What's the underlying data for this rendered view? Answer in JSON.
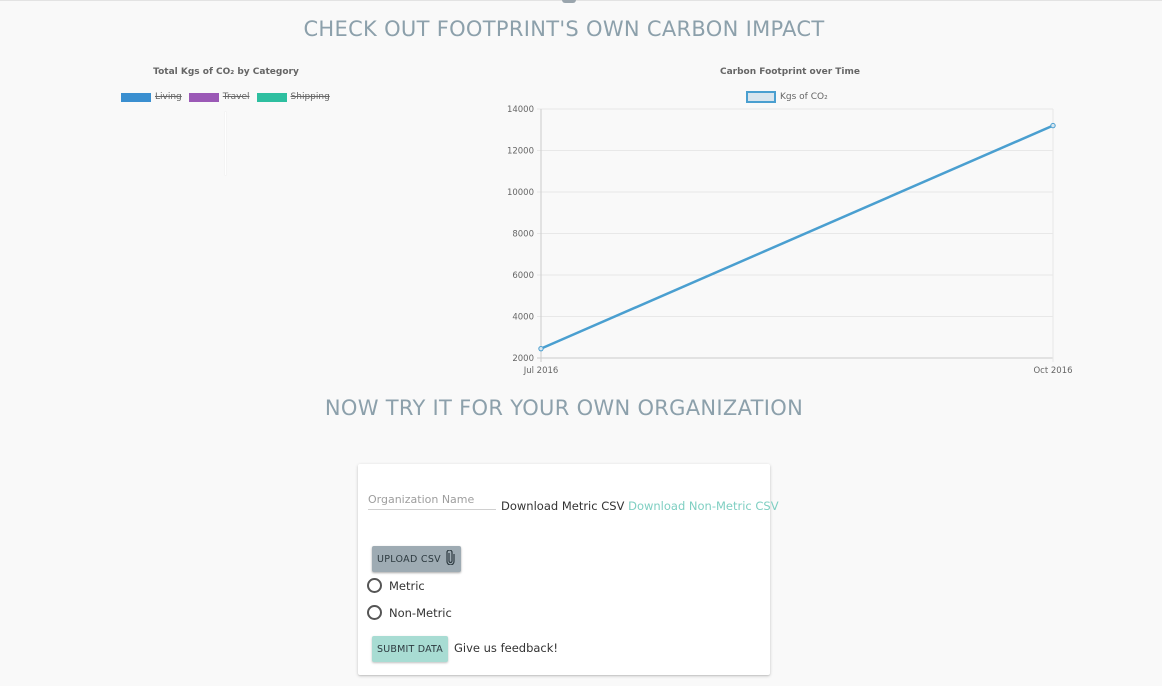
{
  "page": {
    "title_own": "CHECK OUT FOOTPRINT'S OWN CARBON IMPACT",
    "title_try": "NOW TRY IT FOR YOUR OWN ORGANIZATION"
  },
  "colors": {
    "living": "#3a8fd0",
    "travel": "#9b59b6",
    "shipping": "#2ebfa0",
    "line": "#4a9fd0",
    "heading": "#8ca0ab",
    "link_accent": "#7fcfc2"
  },
  "pie_chart": {
    "title": "Total Kgs of CO₂ by Category",
    "legend": [
      "Living",
      "Travel",
      "Shipping"
    ]
  },
  "chart_data": {
    "type": "line",
    "title": "Carbon Footprint over Time",
    "legend": "Kgs of CO₂",
    "x": [
      "Jul 2016",
      "Oct 2016"
    ],
    "series": [
      {
        "name": "Kgs of CO₂",
        "values": [
          2450,
          13200
        ]
      }
    ],
    "yticks": [
      2000,
      4000,
      6000,
      8000,
      10000,
      12000,
      14000
    ],
    "ylim": [
      2000,
      14000
    ],
    "grid": true,
    "legend_position": "top"
  },
  "form": {
    "org_placeholder": "Organization Name",
    "download_metric": "Download Metric CSV",
    "download_nonmetric": "Download Non-Metric CSV",
    "upload_label": "UPLOAD CSV",
    "radio_metric": "Metric",
    "radio_nonmetric": "Non-Metric",
    "submit_label": "SUBMIT DATA",
    "feedback": "Give us feedback!"
  }
}
